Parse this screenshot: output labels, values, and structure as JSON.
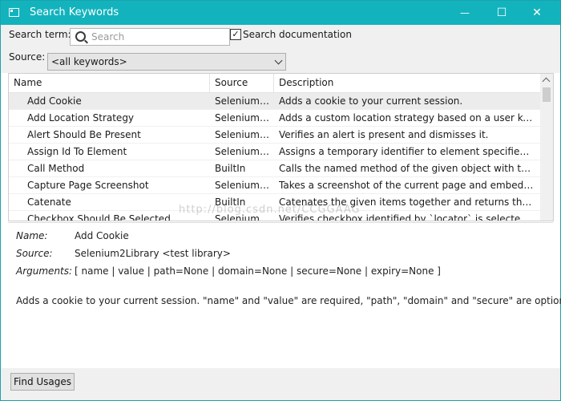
{
  "window": {
    "title": "Search Keywords",
    "minimize": "—",
    "maximize": "☐",
    "close": "✕"
  },
  "search": {
    "label": "Search term:",
    "placeholder": "Search",
    "value": ""
  },
  "doc_checkbox": {
    "label": "Search documentation",
    "checked": true,
    "mark": "✓"
  },
  "source": {
    "label": "Source:",
    "selected": "<all keywords>"
  },
  "table": {
    "columns": [
      "Name",
      "Source",
      "Description"
    ],
    "rows": [
      {
        "name": "Add Cookie",
        "source": "Selenium2...",
        "description": "Adds a cookie to your current session."
      },
      {
        "name": "Add Location Strategy",
        "source": "Selenium2...",
        "description": "Adds a custom location strategy based on a user ke..."
      },
      {
        "name": "Alert Should Be Present",
        "source": "Selenium2...",
        "description": "Verifies an alert is present and dismisses it."
      },
      {
        "name": "Assign Id To Element",
        "source": "Selenium2...",
        "description": "Assigns a temporary identifier to element specified b..."
      },
      {
        "name": "Call Method",
        "source": "BuiltIn",
        "description": "Calls the named method of the given object with the ..."
      },
      {
        "name": "Capture Page Screenshot",
        "source": "Selenium2...",
        "description": "Takes a screenshot of the current page and embeds ..."
      },
      {
        "name": "Catenate",
        "source": "BuiltIn",
        "description": "Catenates the given items together and returns the r..."
      },
      {
        "name": "Checkbox Should Be Selected",
        "source": "Selenium2...",
        "description": "Verifies checkbox identified by `locator` is selected/c..."
      }
    ]
  },
  "watermark": "http://blog.csdn.net/CCGGAAG",
  "details": {
    "name_label": "Name:",
    "name_value": "Add Cookie",
    "source_label": "Source:",
    "source_value": "Selenium2Library <test library>",
    "args_label": "Arguments:",
    "args_value": "[ name | value | path=None | domain=None | secure=None | expiry=None ]",
    "doc": "Adds a cookie to your current session. \"name\" and \"value\" are required, \"path\", \"domain\" and \"secure\" are optional"
  },
  "buttons": {
    "find_usages": "Find Usages"
  }
}
